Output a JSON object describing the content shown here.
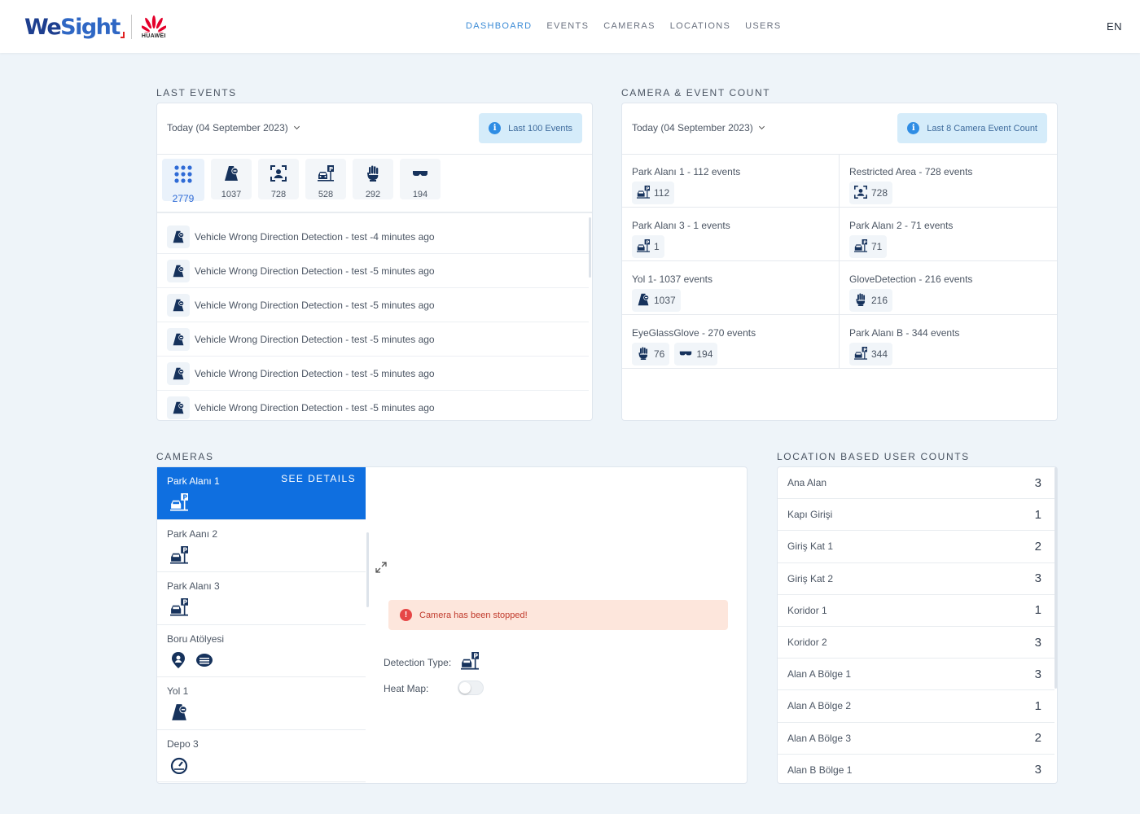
{
  "header": {
    "brand": "WeSight",
    "brand_we": "We",
    "brand_rest": "Sight",
    "partner": "HUAWEI",
    "nav": [
      {
        "label": "DASHBOARD",
        "active": true
      },
      {
        "label": "EVENTS",
        "active": false
      },
      {
        "label": "CAMERAS",
        "active": false
      },
      {
        "label": "LOCATIONS",
        "active": false
      },
      {
        "label": "USERS",
        "active": false
      }
    ],
    "language": "EN"
  },
  "last_events": {
    "title": "LAST EVENTS",
    "date_filter": "Today (04 September 2023)",
    "info_button": "Last 100 Events",
    "tiles": [
      {
        "icon": "grid-icon",
        "count": "2779",
        "selected": true
      },
      {
        "icon": "wrong-direction-icon",
        "count": "1037",
        "selected": false
      },
      {
        "icon": "face-detection-icon",
        "count": "728",
        "selected": false
      },
      {
        "icon": "parking-icon",
        "count": "528",
        "selected": false
      },
      {
        "icon": "glove-icon",
        "count": "292",
        "selected": false
      },
      {
        "icon": "glasses-icon",
        "count": "194",
        "selected": false
      }
    ],
    "events": [
      {
        "icon": "wrong-direction-icon",
        "text": "Vehicle Wrong Direction Detection - test -4 minutes ago"
      },
      {
        "icon": "wrong-direction-icon",
        "text": "Vehicle Wrong Direction Detection - test -5 minutes ago"
      },
      {
        "icon": "wrong-direction-icon",
        "text": "Vehicle Wrong Direction Detection - test -5 minutes ago"
      },
      {
        "icon": "wrong-direction-icon",
        "text": "Vehicle Wrong Direction Detection - test -5 minutes ago"
      },
      {
        "icon": "wrong-direction-icon",
        "text": "Vehicle Wrong Direction Detection - test -5 minutes ago"
      },
      {
        "icon": "wrong-direction-icon",
        "text": "Vehicle Wrong Direction Detection - test -5 minutes ago"
      }
    ]
  },
  "camera_event_count": {
    "title": "CAMERA & EVENT COUNT",
    "date_filter": "Today (04 September 2023)",
    "info_button": "Last 8 Camera Event Count",
    "cameras": [
      {
        "title": "Park Alanı 1 - 112 events",
        "badges": [
          {
            "icon": "parking-icon",
            "count": "112"
          }
        ]
      },
      {
        "title": "Restricted Area - 728 events",
        "badges": [
          {
            "icon": "face-detection-icon",
            "count": "728"
          }
        ]
      },
      {
        "title": "Park Alanı 3 - 1 events",
        "badges": [
          {
            "icon": "parking-icon",
            "count": "1"
          }
        ]
      },
      {
        "title": "Park Alanı 2 - 71 events",
        "badges": [
          {
            "icon": "parking-icon",
            "count": "71"
          }
        ]
      },
      {
        "title": "Yol 1- 1037 events",
        "badges": [
          {
            "icon": "wrong-direction-icon",
            "count": "1037"
          }
        ]
      },
      {
        "title": "GloveDetection - 216 events",
        "badges": [
          {
            "icon": "glove-icon",
            "count": "216"
          }
        ]
      },
      {
        "title": "EyeGlassGlove - 270 events",
        "badges": [
          {
            "icon": "glove-icon",
            "count": "76"
          },
          {
            "icon": "glasses-icon",
            "count": "194"
          }
        ]
      },
      {
        "title": "Park Alanı B - 344 events",
        "badges": [
          {
            "icon": "parking-icon",
            "count": "344"
          }
        ]
      }
    ]
  },
  "cameras": {
    "title": "CAMERAS",
    "see_details": "SEE DETAILS",
    "items": [
      {
        "name": "Park Alanı 1",
        "icons": [
          "parking-icon"
        ],
        "selected": true
      },
      {
        "name": "Park Aanı 2",
        "icons": [
          "parking-icon"
        ],
        "selected": false
      },
      {
        "name": "Park Alanı 3",
        "icons": [
          "parking-icon"
        ],
        "selected": false
      },
      {
        "name": "Boru Atölyesi",
        "icons": [
          "location-pin-icon",
          "mask-icon"
        ],
        "selected": false
      },
      {
        "name": "Yol 1",
        "icons": [
          "wrong-direction-icon"
        ],
        "selected": false
      },
      {
        "name": "Depo 3",
        "icons": [
          "speedometer-icon"
        ],
        "selected": false
      }
    ],
    "alert": "Camera has been stopped!",
    "detection_type_label": "Detection Type:",
    "detection_type_icon": "parking-icon",
    "heat_map_label": "Heat Map:",
    "heat_map_on": false
  },
  "location_counts": {
    "title": "LOCATION BASED USER COUNTS",
    "items": [
      {
        "name": "Ana Alan",
        "count": "3"
      },
      {
        "name": "Kapı Girişi",
        "count": "1"
      },
      {
        "name": "Giriş Kat 1",
        "count": "2"
      },
      {
        "name": "Giriş Kat 2",
        "count": "3"
      },
      {
        "name": "Koridor 1",
        "count": "1"
      },
      {
        "name": "Koridor 2",
        "count": "3"
      },
      {
        "name": "Alan A Bölge 1",
        "count": "3"
      },
      {
        "name": "Alan A Bölge 2",
        "count": "1"
      },
      {
        "name": "Alan A Bölge 3",
        "count": "2"
      },
      {
        "name": "Alan B Bölge 1",
        "count": "3"
      }
    ]
  },
  "colors": {
    "accent": "#0f6fe0",
    "icon": "#16325c",
    "info_bg": "#d5ecfa",
    "alert_bg": "#fde6dc",
    "alert_icon": "#e64646"
  }
}
